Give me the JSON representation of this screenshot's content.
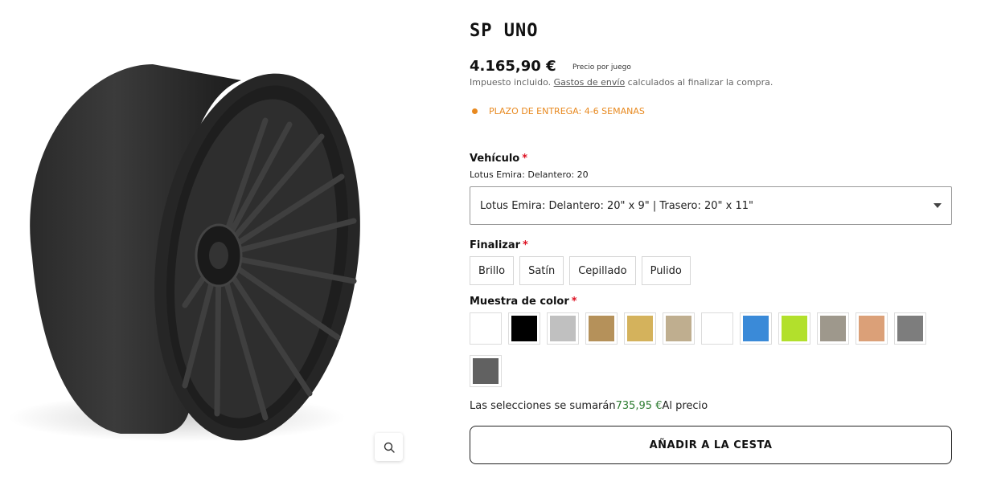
{
  "product": {
    "title": "SP UNO",
    "price": "4.165,90 €",
    "price_note": "Precio por juego",
    "tax_prefix": "Impuesto incluido. ",
    "tax_link": "Gastos de envío",
    "tax_suffix": " calculados al finalizar la compra.",
    "delivery": "PLAZO DE ENTREGA: 4-6 SEMANAS",
    "delivery_color": "#e8891f",
    "image_icon": "zoom-magnifier-icon"
  },
  "vehicle": {
    "label": "Vehículo",
    "required_mark": "*",
    "current": "Lotus Emira: Delantero: 20",
    "selected_option": "Lotus Emira: Delantero: 20\" x 9\" | Trasero: 20\" x 11\""
  },
  "finish": {
    "label": "Finalizar",
    "required_mark": "*",
    "options": [
      "Brillo",
      "Satín",
      "Cepillado",
      "Pulido"
    ]
  },
  "color": {
    "label": "Muestra de color",
    "required_mark": "*",
    "swatches": [
      "#ffffff",
      "#000000",
      "#c0c0c0",
      "#b5915a",
      "#d4b25c",
      "#bfae8f",
      "#ffffff",
      "#3a8ad8",
      "#b2e02c",
      "#9e988c",
      "#dba078",
      "#7d7d7d",
      "#616161"
    ]
  },
  "summary": {
    "prefix": "Las selecciones se sumarán",
    "amount": "735,95 €",
    "suffix": "Al precio"
  },
  "cart": {
    "label": "AÑADIR A LA CESTA"
  }
}
